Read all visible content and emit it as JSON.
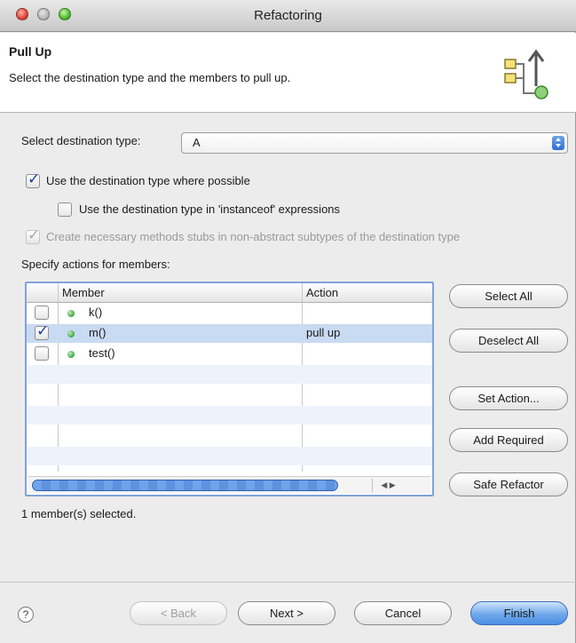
{
  "window": {
    "title": "Refactoring"
  },
  "header": {
    "title": "Pull Up",
    "description": "Select the destination type and the members to pull up."
  },
  "destination": {
    "label": "Select destination type:",
    "value": "A"
  },
  "options": {
    "use_destination": {
      "label": "Use the destination type where possible",
      "checked": true
    },
    "instanceof": {
      "label": "Use the destination type in 'instanceof' expressions",
      "checked": false
    },
    "create_stubs": {
      "label": "Create necessary methods stubs in non-abstract subtypes of the destination type",
      "checked": true,
      "disabled": true
    }
  },
  "members": {
    "label": "Specify actions for members:",
    "columns": {
      "member": "Member",
      "action": "Action"
    },
    "rows": [
      {
        "name": "k()",
        "action": "",
        "checked": false
      },
      {
        "name": "m()",
        "action": "pull up",
        "checked": true
      },
      {
        "name": "test()",
        "action": "",
        "checked": false
      }
    ]
  },
  "side_buttons": {
    "select_all": "Select All",
    "deselect_all": "Deselect All",
    "set_action": "Set Action...",
    "add_required": "Add Required",
    "safe_refactor": "Safe Refactor"
  },
  "status": "1 member(s) selected.",
  "footer": {
    "help": "?",
    "back": "< Back",
    "next": "Next >",
    "cancel": "Cancel",
    "finish": "Finish"
  },
  "colors": {
    "accent": "#4b8fe4",
    "selection": "#c9daf3",
    "member_dot": "#3aa640"
  }
}
